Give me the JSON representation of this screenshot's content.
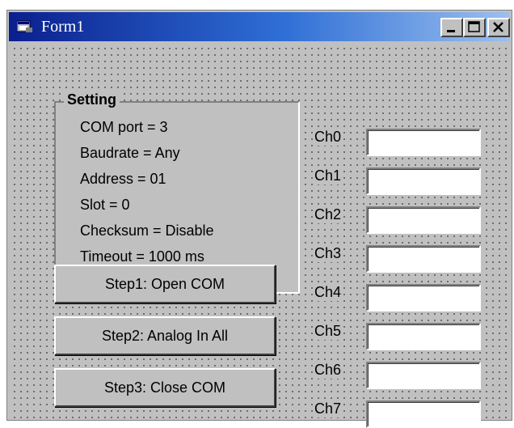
{
  "window": {
    "title": "Form1"
  },
  "setting": {
    "title": "Setting",
    "lines": [
      "COM port = 3",
      "Baudrate = Any",
      "Address = 01",
      "Slot = 0",
      "Checksum = Disable",
      "Timeout = 1000 ms"
    ]
  },
  "buttons": {
    "open": "Step1: Open COM",
    "analog": "Step2: Analog In All",
    "close": "Step3: Close COM"
  },
  "channels": [
    {
      "label": "Ch0",
      "value": ""
    },
    {
      "label": "Ch1",
      "value": ""
    },
    {
      "label": "Ch2",
      "value": ""
    },
    {
      "label": "Ch3",
      "value": ""
    },
    {
      "label": "Ch4",
      "value": ""
    },
    {
      "label": "Ch5",
      "value": ""
    },
    {
      "label": "Ch6",
      "value": ""
    },
    {
      "label": "Ch7",
      "value": ""
    }
  ]
}
